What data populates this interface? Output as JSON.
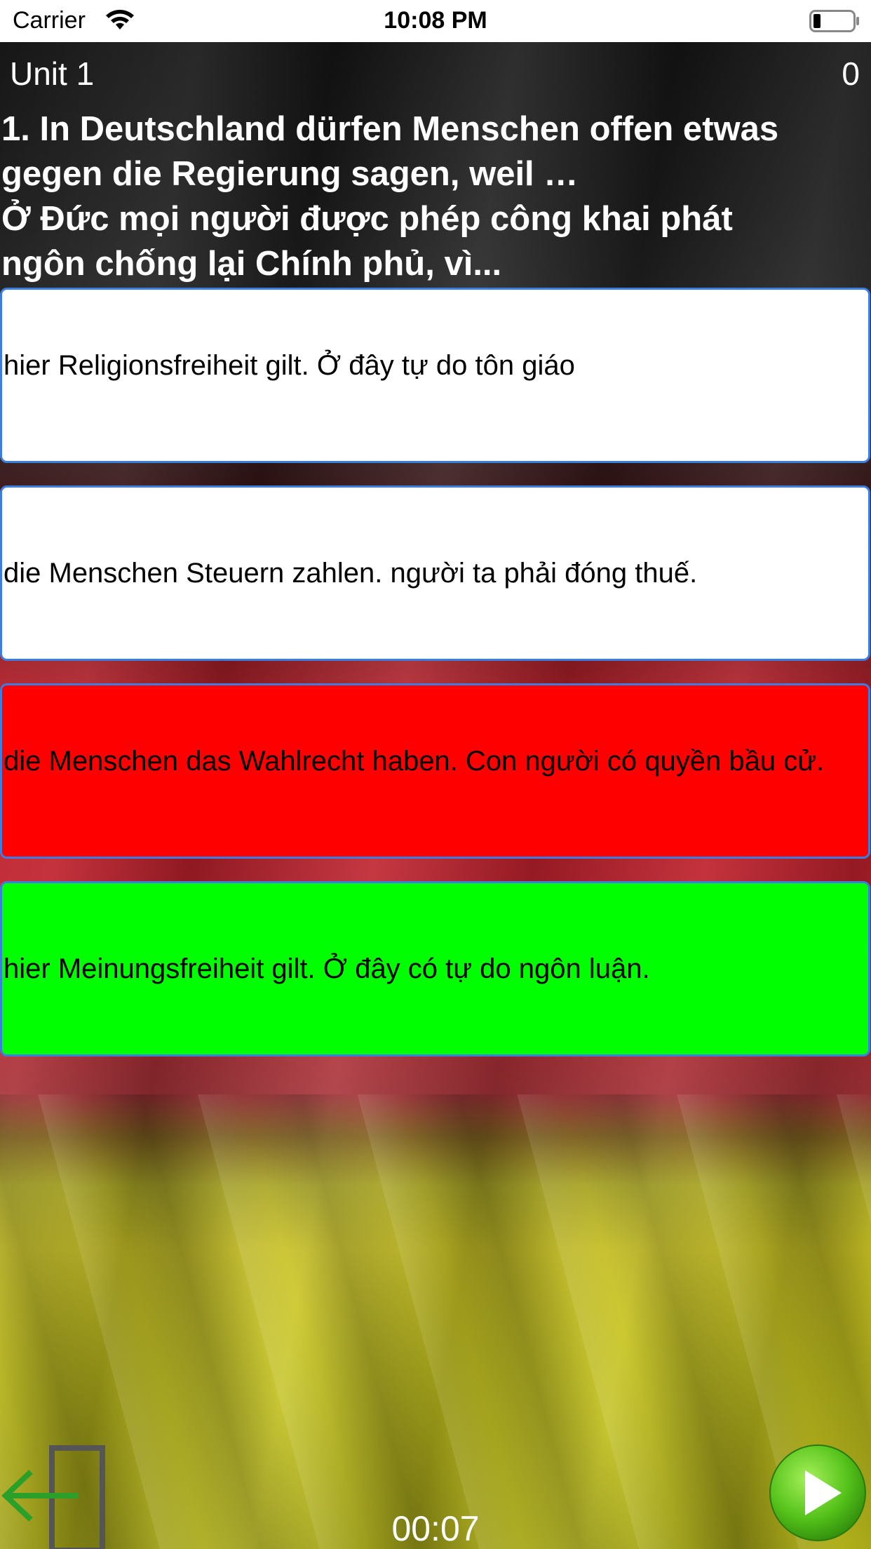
{
  "status_bar": {
    "carrier": "Carrier",
    "time": "10:08 PM",
    "wifi_icon": "wifi-icon",
    "battery_icon": "battery-icon"
  },
  "header": {
    "unit": "Unit 1",
    "score": "0"
  },
  "question": {
    "line_1": "1. In Deutschland dürfen Menschen offen etwas",
    "line_2": "gegen die Regierung sagen, weil …",
    "line_3": "Ở Đức mọi người được phép công khai phát",
    "line_4": "ngôn chống lại Chính phủ, vì..."
  },
  "answers": [
    {
      "text": "hier Religionsfreiheit gilt. Ở đây tự do tôn giáo",
      "state": "neutral",
      "color": "#ffffff"
    },
    {
      "text": "die Menschen Steuern zahlen. người ta phải đóng thuế.",
      "state": "neutral",
      "color": "#ffffff"
    },
    {
      "text": "die Menschen das Wahlrecht haben. Con người có quyền bầu cử.",
      "state": "wrong",
      "color": "#ff0000"
    },
    {
      "text": "hier Meinungsfreiheit gilt. Ở đây có tự do ngôn luận.",
      "state": "correct",
      "color": "#00ff00"
    }
  ],
  "footer": {
    "timer": "00:07",
    "exit_icon": "exit-icon",
    "play_icon": "play-icon"
  },
  "colors": {
    "answer_border": "#3b7de0",
    "wrong": "#ff0000",
    "correct": "#00ff00",
    "exit_arrow": "#2aa02a",
    "play_button": "#55c21a"
  }
}
